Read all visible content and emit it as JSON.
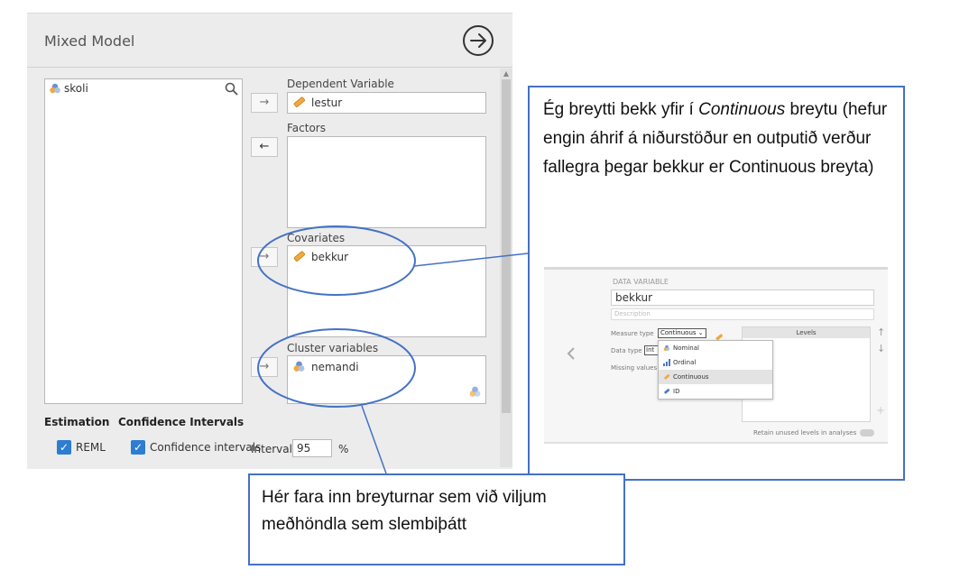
{
  "panel": {
    "title": "Mixed Model",
    "variables": [
      {
        "name": "skoli"
      }
    ],
    "dependent": {
      "label": "Dependent Variable",
      "value": "lestur"
    },
    "factors": {
      "label": "Factors"
    },
    "covariates": {
      "label": "Covariates",
      "items": [
        "bekkur"
      ]
    },
    "cluster": {
      "label": "Cluster variables",
      "items": [
        "nemandi"
      ]
    },
    "estimation": {
      "heading": "Estimation",
      "reml": "REML",
      "reml_checked": true
    },
    "ci": {
      "heading": "Confidence Intervals",
      "label": "Confidence intervals",
      "checked": true,
      "interval_label": "Interval",
      "interval_value": "95",
      "unit": "%"
    }
  },
  "arrows": {
    "right": "→",
    "left": "←"
  },
  "callout_top": {
    "pre": "Ég breytti bekk yfir í ",
    "emph": "Continuous",
    "post": " breytu (hefur engin áhrif á niðurstöður en outputið verður fallegra þegar bekkur er Continuous breyta)"
  },
  "callout_bottom": {
    "text": "Hér fara inn breyturnar sem við viljum meðhöndla sem slembiþátt"
  },
  "inset": {
    "section_label": "DATA VARIABLE",
    "name": "bekkur",
    "description_placeholder": "Description",
    "measure_type_label": "Measure type",
    "measure_type_value": "Continuous",
    "data_type_label": "Data type",
    "data_type_value": "Int",
    "missing_values_label": "Missing values",
    "levels_header": "Levels",
    "options": [
      "Nominal",
      "Ordinal",
      "Continuous",
      "ID"
    ],
    "selected_option": "Continuous",
    "retain_label": "Retain unused levels in analyses"
  },
  "colors": {
    "accent": "#4472c4",
    "checkbox": "#2d7dd2",
    "ruler": "#f0a93b"
  }
}
